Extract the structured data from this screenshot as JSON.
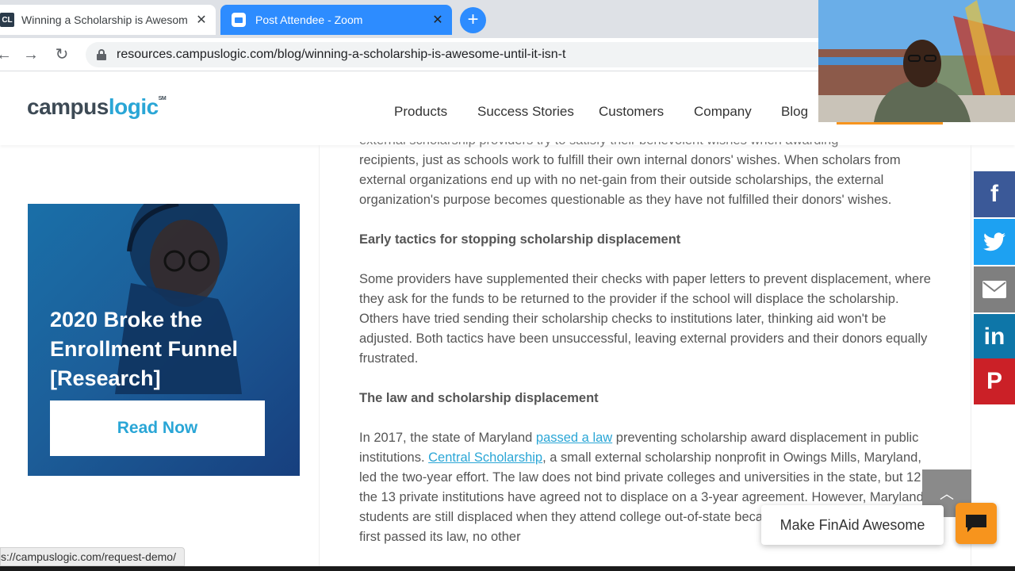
{
  "browser": {
    "tabs": [
      {
        "title": "Winning a Scholarship is Awesom",
        "favicon": "CL"
      },
      {
        "title": "Post Attendee - Zoom"
      }
    ],
    "new_tab": "+",
    "url": "resources.campuslogic.com/blog/winning-a-scholarship-is-awesome-until-it-isn-t",
    "status_url": "s://campuslogic.com/request-demo/"
  },
  "site": {
    "logo": {
      "part1": "campus",
      "part2": "logic",
      "mark": "SM"
    },
    "nav": [
      "Products",
      "Success Stories",
      "Customers",
      "Company",
      "Blog"
    ],
    "accent_color": "#f7941d",
    "brand_color": "#2aa6d6"
  },
  "sidebar_ad": {
    "title": "2020 Broke the Enrollment Funnel [Research]",
    "button": "Read Now"
  },
  "article": {
    "partial_top": "external scholarship providers try to satisfy their benevolent wishes when awarding",
    "para1": "recipients, just as schools work to fulfill their own internal donors' wishes. When scholars from external organizations end up with no net-gain from their outside scholarships, the external organization's purpose becomes questionable as they have not fulfilled their donors' wishes.",
    "heading1": "Early tactics for stopping scholarship displacement",
    "para2": "Some providers have supplemented their checks with paper letters to prevent displacement, where they ask for the funds to be returned to the provider if the school will displace the scholarship. Others have tried sending their scholarship checks to institutions later, thinking aid won't be adjusted. Both tactics have been unsuccessful, leaving external providers and their donors equally frustrated.",
    "heading2": "The law and scholarship displacement",
    "para3": {
      "t1": "In 2017, the state of Maryland ",
      "link1": "passed a law",
      "t2": " preventing scholarship award displacement in public institutions. ",
      "link2": "Central Scholarship",
      "t3": ", a small external scholarship nonprofit in Owings Mills, Maryland, led the two-year effort. The law does not bind private colleges and universities in the state, but 12 of the 13 private institutions have agreed not to displace on a 3-year agreement. However, Maryland students are still displaced when they attend college out-of-state because four years after Maryland first passed its law, no other"
    }
  },
  "social": {
    "facebook": "f",
    "linkedin": "in",
    "pinterest": "P"
  },
  "widgets": {
    "chat_prompt": "Make FinAid Awesome"
  }
}
